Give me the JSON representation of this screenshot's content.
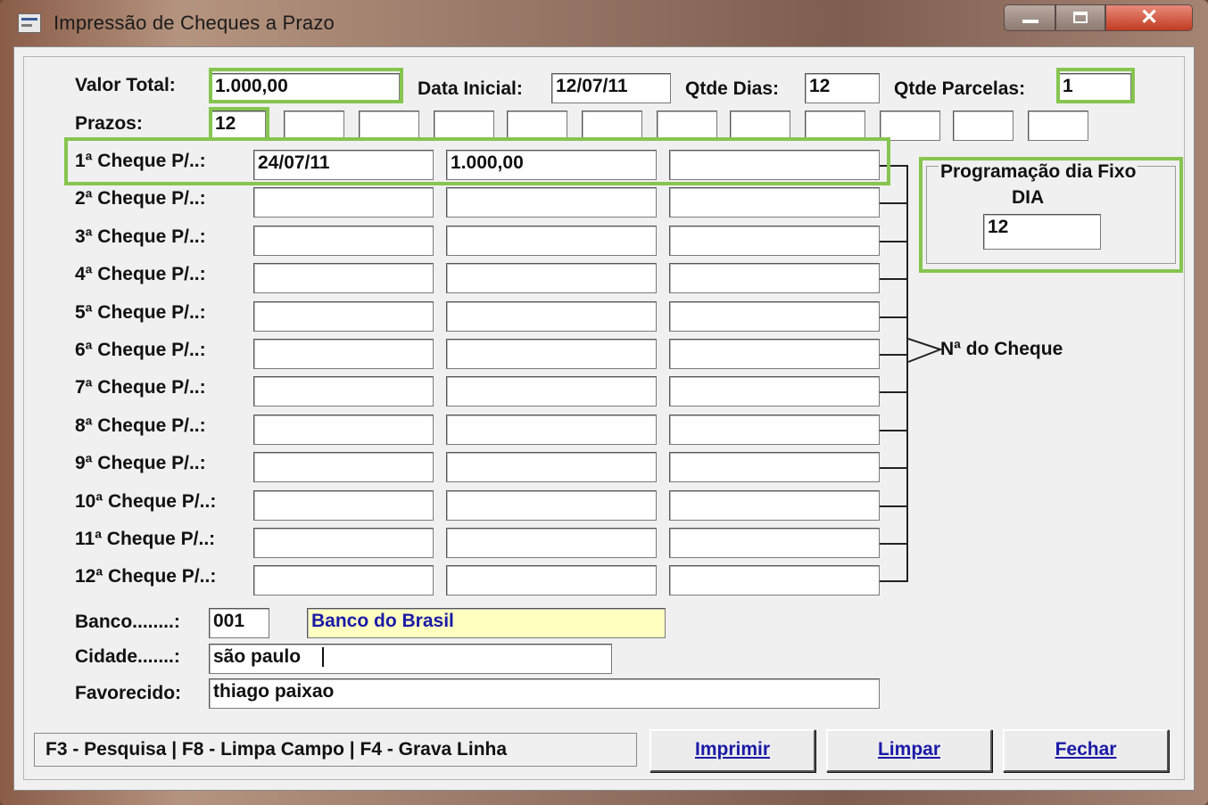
{
  "window": {
    "title": "Impressão de Cheques a Prazo",
    "buttons": {
      "minimize": "minimize",
      "maximize": "maximize",
      "close": "✕"
    }
  },
  "header": {
    "valor_total": {
      "label": "Valor Total:",
      "value": "1.000,00"
    },
    "data_inicial": {
      "label": "Data Inicial:",
      "value": "12/07/11"
    },
    "qtde_dias": {
      "label": "Qtde Dias:",
      "value": "12"
    },
    "qtde_parcelas": {
      "label": "Qtde Parcelas:",
      "value": "1"
    }
  },
  "prazos": {
    "label": "Prazos:",
    "values": [
      "12",
      "",
      "",
      "",
      "",
      "",
      "",
      "",
      "",
      "",
      "",
      ""
    ]
  },
  "cheques": [
    {
      "label": "1ª Cheque P/..:",
      "date": "24/07/11",
      "amount": "1.000,00",
      "number": ""
    },
    {
      "label": "2ª Cheque P/..:",
      "date": "",
      "amount": "",
      "number": ""
    },
    {
      "label": "3ª Cheque P/..:",
      "date": "",
      "amount": "",
      "number": ""
    },
    {
      "label": "4ª Cheque P/..:",
      "date": "",
      "amount": "",
      "number": ""
    },
    {
      "label": "5ª Cheque P/..:",
      "date": "",
      "amount": "",
      "number": ""
    },
    {
      "label": "6ª Cheque P/..:",
      "date": "",
      "amount": "",
      "number": ""
    },
    {
      "label": "7ª Cheque P/..:",
      "date": "",
      "amount": "",
      "number": ""
    },
    {
      "label": "8ª Cheque P/..:",
      "date": "",
      "amount": "",
      "number": ""
    },
    {
      "label": "9ª Cheque P/..:",
      "date": "",
      "amount": "",
      "number": ""
    },
    {
      "label": "10ª Cheque P/..:",
      "date": "",
      "amount": "",
      "number": ""
    },
    {
      "label": "11ª Cheque P/..:",
      "date": "",
      "amount": "",
      "number": ""
    },
    {
      "label": "12ª Cheque P/..:",
      "date": "",
      "amount": "",
      "number": ""
    }
  ],
  "annotation": {
    "numero_cheque": "Nª do Cheque"
  },
  "programacao": {
    "title": "Programação dia Fixo",
    "subtitle": "DIA",
    "value": "12"
  },
  "banco": {
    "label": "Banco........:",
    "code": "001",
    "name": "Banco do Brasil"
  },
  "cidade": {
    "label": "Cidade.......:",
    "value": "são paulo"
  },
  "favorecido": {
    "label": "Favorecido:",
    "value": "thiago paixao"
  },
  "status": {
    "text": "F3 - Pesquisa  |  F8 - Limpa Campo  |  F4 - Grava Linha"
  },
  "actions": {
    "imprimir": "Imprimir",
    "limpar": "Limpar",
    "fechar": "Fechar"
  },
  "colors": {
    "highlight": "#86c54f",
    "bank_field_bg": "#ffffc0",
    "link_blue": "#1a1aa8"
  }
}
